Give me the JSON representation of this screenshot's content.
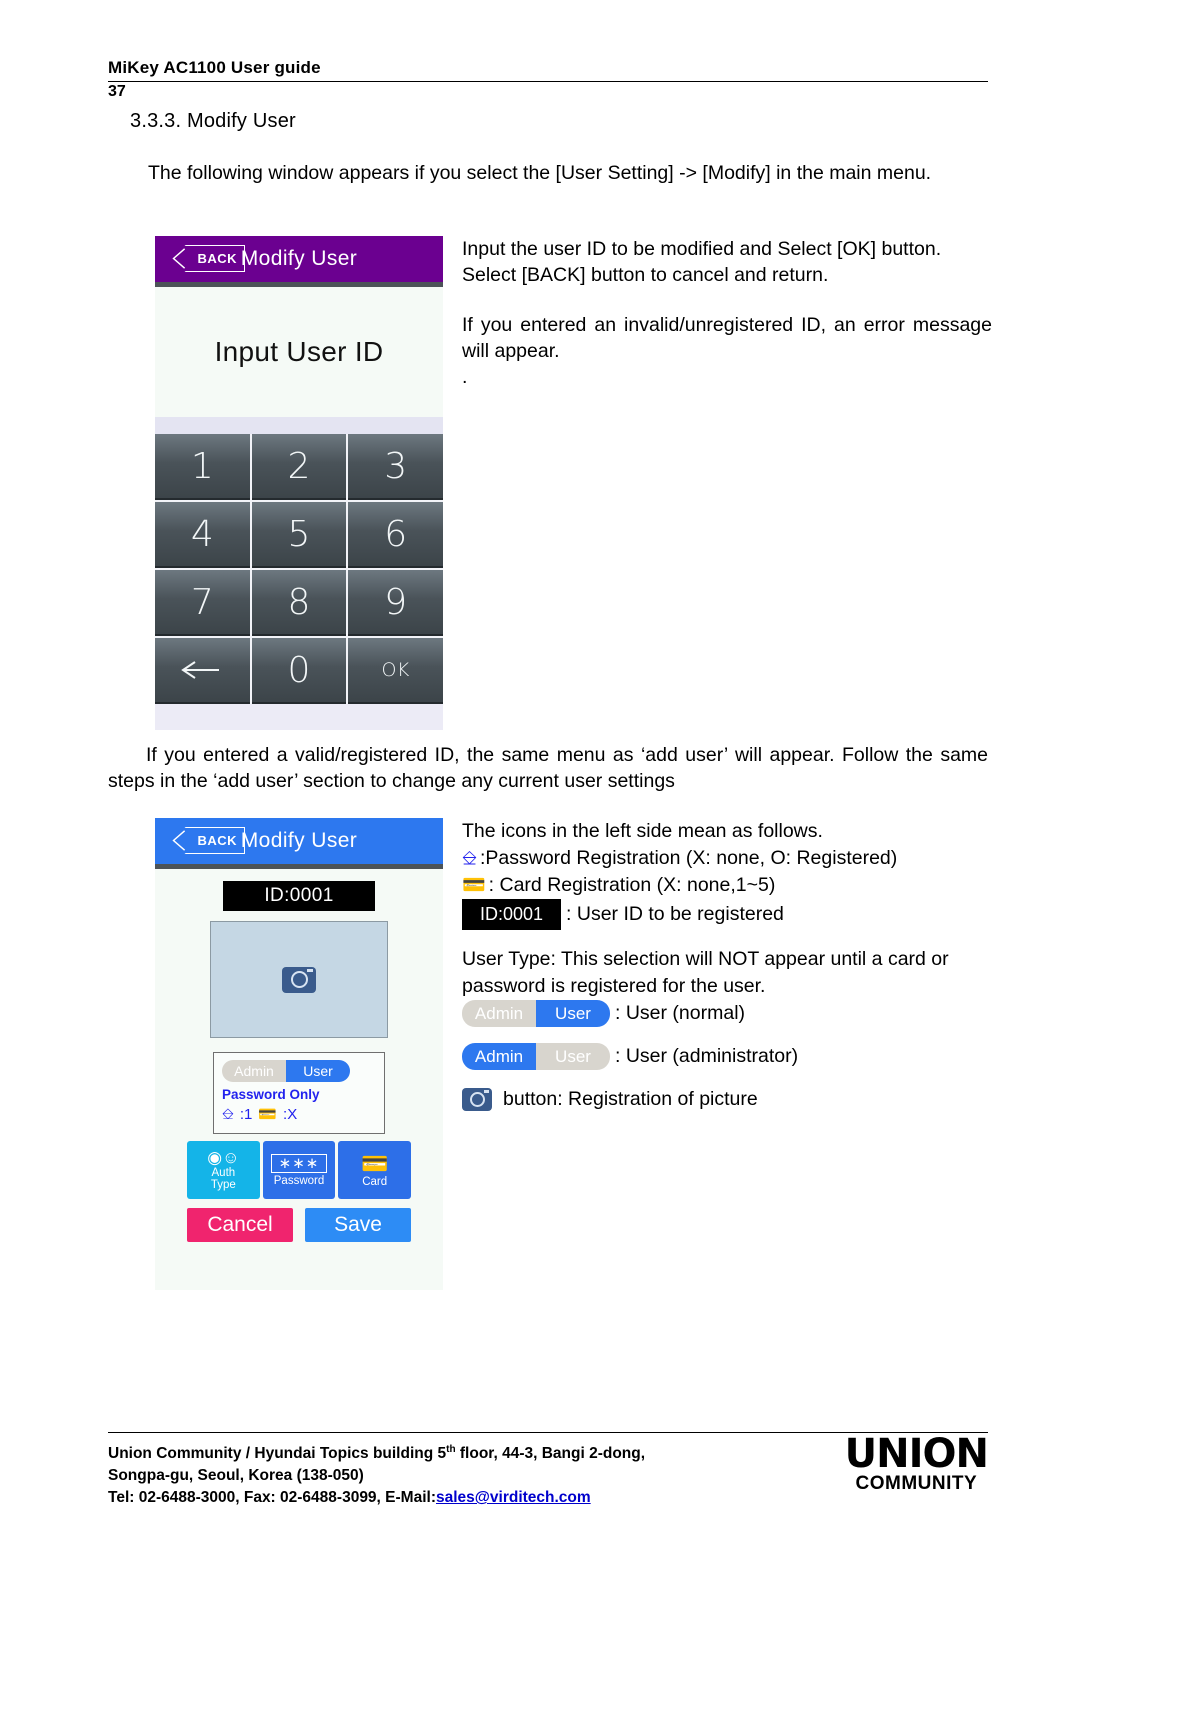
{
  "header": {
    "title": "MiKey AC1100 User guide",
    "page_number": "37"
  },
  "section": {
    "heading": "3.3.3. Modify User"
  },
  "paragraphs": {
    "intro": "The following window appears if you select the [User Setting] -> [Modify] in the main menu.",
    "middle": "If you entered a valid/registered ID, the same menu as ‘add user’ will appear. Follow the same steps in the ‘add user’ section to change any current user settings"
  },
  "annotation1": {
    "line1": "Input the user ID to be modified and Select [OK] button.",
    "line2": "Select [BACK] button to cancel and return.",
    "line3": "If you entered an invalid/unregistered ID, an error message will appear.",
    "line4": "."
  },
  "annotation2": {
    "intro": "The icons in the left side mean as follows.",
    "password_reg": ":Password Registration (X: none, O: Registered)",
    "card_reg": ":   Card Registration (X: none,1~5)",
    "id_badge_text": "ID:0001",
    "id_desc": ": User ID to be registered",
    "user_type_note": "User Type: This selection will NOT appear until a card or password is registered for the user.",
    "seg_admin": "Admin",
    "seg_user": "User",
    "user_normal_desc": ": User (normal)",
    "user_admin_desc": ": User (administrator)",
    "camera_desc": "button: Registration of picture"
  },
  "device1": {
    "back_label": "BACK",
    "title": "Modify User",
    "prompt": "Input User ID",
    "keys": [
      "1",
      "2",
      "3",
      "4",
      "5",
      "6",
      "7",
      "8",
      "9",
      "←",
      "0",
      "OK"
    ]
  },
  "device2": {
    "back_label": "BACK",
    "title": "Modify User",
    "id_badge": "ID:0001",
    "camera_icon": "camera-icon",
    "seg_admin": "Admin",
    "seg_user": "User",
    "password_only": "Password Only",
    "pw_count": ":1",
    "card_count": ":X",
    "auth_type_line1": "Auth",
    "auth_type_line2": "Type",
    "password_label": "Password",
    "password_mask": "∗∗∗",
    "card_label": "Card",
    "cancel_label": "Cancel",
    "save_label": "Save"
  },
  "footer": {
    "line1_a": "Union Community / Hyundai Topics building 5",
    "line1_sup": "th",
    "line1_b": " floor, 44-3, Bangi 2-dong,",
    "line2": "Songpa-gu, Seoul, Korea (138-050)",
    "line3_a": "Tel: 02-6488-3000, Fax: 02-6488-3099, E-Mail:",
    "line3_link": "sales@virditech.com",
    "logo_word": "UNION",
    "logo_sub": "COMMUNITY"
  },
  "colors": {
    "purple_bar": "#6b0090",
    "blue_bar": "#2d78ef",
    "cancel": "#f0246e",
    "save": "#2d8cf5",
    "link": "#0000cc"
  }
}
